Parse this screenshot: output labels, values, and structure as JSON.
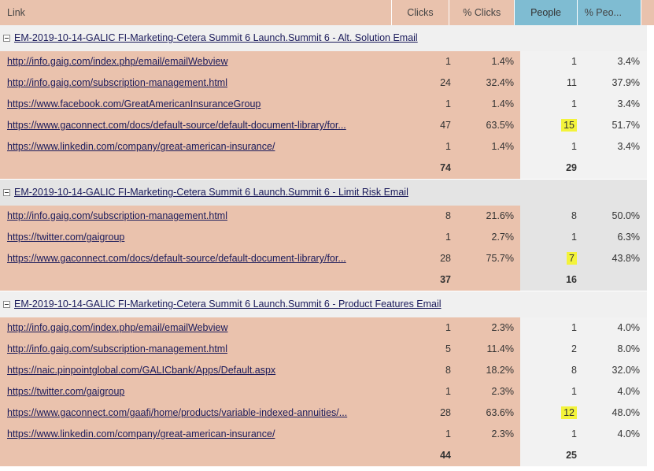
{
  "columns": {
    "link": "Link",
    "clicks": "Clicks",
    "pct_clicks": "% Clicks",
    "people": "People",
    "pct_people": "% Peo..."
  },
  "groups": [
    {
      "title": "EM-2019-10-14-GALIC FI-Marketing-Cetera Summit 6 Launch.Summit 6 - Alt. Solution Email",
      "rows": [
        {
          "link": "http://info.gaig.com/index.php/email/emailWebview",
          "clicks": "1",
          "pct_clicks": "1.4%",
          "people": "1",
          "pct_people": "3.4%",
          "highlight": false
        },
        {
          "link": "http://info.gaig.com/subscription-management.html",
          "clicks": "24",
          "pct_clicks": "32.4%",
          "people": "11",
          "pct_people": "37.9%",
          "highlight": false
        },
        {
          "link": "https://www.facebook.com/GreatAmericanInsuranceGroup",
          "clicks": "1",
          "pct_clicks": "1.4%",
          "people": "1",
          "pct_people": "3.4%",
          "highlight": false
        },
        {
          "link": "https://www.gaconnect.com/docs/default-source/default-document-library/for...",
          "clicks": "47",
          "pct_clicks": "63.5%",
          "people": "15",
          "pct_people": "51.7%",
          "highlight": true
        },
        {
          "link": "https://www.linkedin.com/company/great-american-insurance/",
          "clicks": "1",
          "pct_clicks": "1.4%",
          "people": "1",
          "pct_people": "3.4%",
          "highlight": false
        }
      ],
      "total_clicks": "74",
      "total_people": "29"
    },
    {
      "title": "EM-2019-10-14-GALIC FI-Marketing-Cetera Summit 6 Launch.Summit 6 - Limit Risk Email",
      "rows": [
        {
          "link": "http://info.gaig.com/subscription-management.html",
          "clicks": "8",
          "pct_clicks": "21.6%",
          "people": "8",
          "pct_people": "50.0%",
          "highlight": false
        },
        {
          "link": "https://twitter.com/gaigroup",
          "clicks": "1",
          "pct_clicks": "2.7%",
          "people": "1",
          "pct_people": "6.3%",
          "highlight": false
        },
        {
          "link": "https://www.gaconnect.com/docs/default-source/default-document-library/for...",
          "clicks": "28",
          "pct_clicks": "75.7%",
          "people": "7",
          "pct_people": "43.8%",
          "highlight": true
        }
      ],
      "total_clicks": "37",
      "total_people": "16"
    },
    {
      "title": "EM-2019-10-14-GALIC FI-Marketing-Cetera Summit 6 Launch.Summit 6 - Product Features Email",
      "rows": [
        {
          "link": "http://info.gaig.com/index.php/email/emailWebview",
          "clicks": "1",
          "pct_clicks": "2.3%",
          "people": "1",
          "pct_people": "4.0%",
          "highlight": false
        },
        {
          "link": "http://info.gaig.com/subscription-management.html",
          "clicks": "5",
          "pct_clicks": "11.4%",
          "people": "2",
          "pct_people": "8.0%",
          "highlight": false
        },
        {
          "link": "https://naic.pinpointglobal.com/GALICbank/Apps/Default.aspx",
          "clicks": "8",
          "pct_clicks": "18.2%",
          "people": "8",
          "pct_people": "32.0%",
          "highlight": false
        },
        {
          "link": "https://twitter.com/gaigroup",
          "clicks": "1",
          "pct_clicks": "2.3%",
          "people": "1",
          "pct_people": "4.0%",
          "highlight": false
        },
        {
          "link": "https://www.gaconnect.com/gaafi/home/products/variable-indexed-annuities/...",
          "clicks": "28",
          "pct_clicks": "63.6%",
          "people": "12",
          "pct_people": "48.0%",
          "highlight": true
        },
        {
          "link": "https://www.linkedin.com/company/great-american-insurance/",
          "clicks": "1",
          "pct_clicks": "2.3%",
          "people": "1",
          "pct_people": "4.0%",
          "highlight": false
        }
      ],
      "total_clicks": "44",
      "total_people": "25"
    }
  ],
  "colors": {
    "clicks_bg": "#eac2ad",
    "people_header_bg": "#7fbcd2",
    "highlight": "#f3f33a",
    "link_text": "#1a1a5a"
  }
}
